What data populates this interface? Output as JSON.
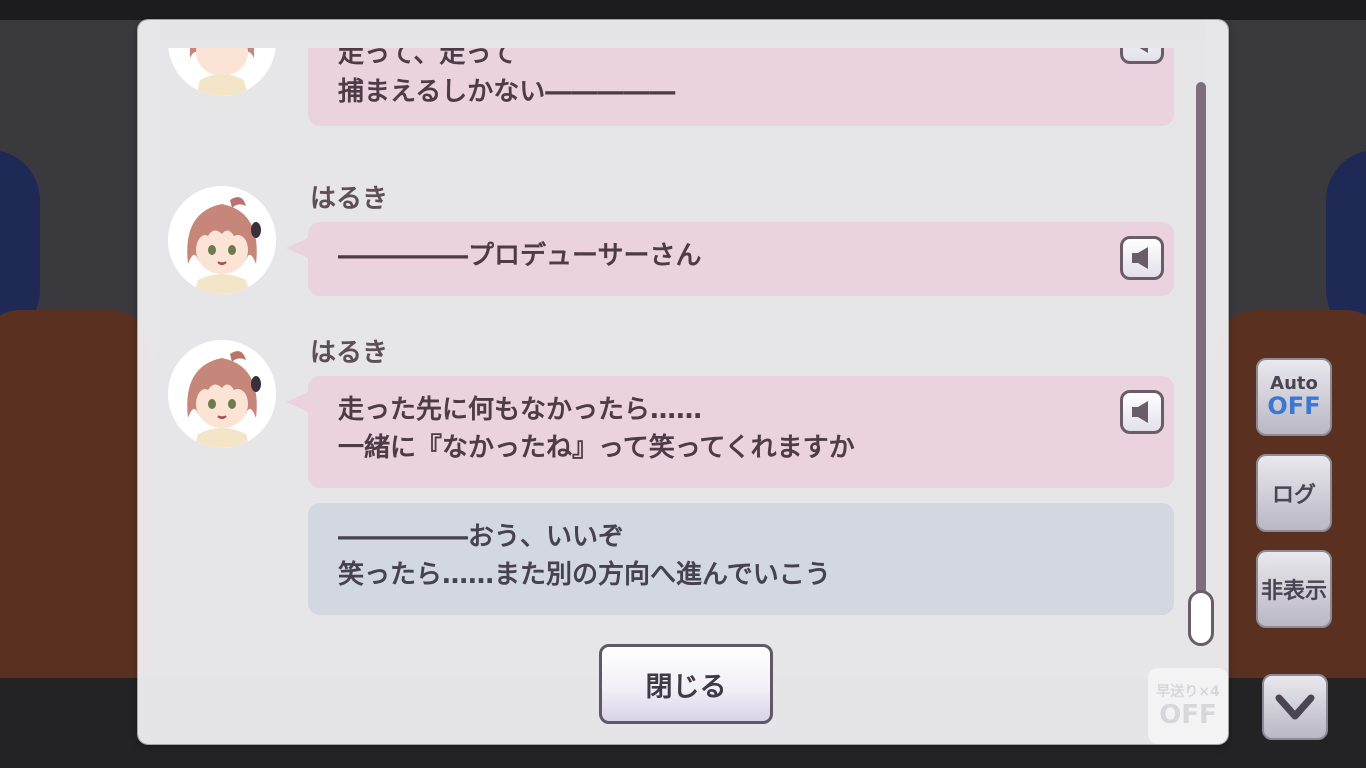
{
  "log": {
    "entries": [
      {
        "speaker": "",
        "lines": [
          "走って、走って",
          "捕まえるしかない―――――"
        ],
        "has_voice": true
      },
      {
        "speaker": "はるき",
        "lines": [
          "―――――プロデューサーさん"
        ],
        "has_voice": true
      },
      {
        "speaker": "はるき",
        "lines": [
          "走った先に何もなかったら……",
          "一緒に『なかったね』って笑ってくれますか"
        ],
        "has_voice": true
      },
      {
        "speaker": "",
        "lines": [
          "―――――おう、いいぞ",
          "笑ったら……また別の方向へ進んでいこう"
        ],
        "has_voice": false
      }
    ],
    "close_label": "閉じる"
  },
  "controls": {
    "auto_label": "Auto",
    "auto_state": "OFF",
    "log_label": "ログ",
    "hide_label": "非表示",
    "fast_forward_label": "早送り×4",
    "fast_forward_state": "OFF"
  },
  "colors": {
    "speaker_bubble": "#ead2df",
    "player_bubble": "#d3d7e0",
    "auto_off": "#3a78d4"
  },
  "icons": {
    "voice": "speaker-icon",
    "down": "chevron-down-icon"
  }
}
